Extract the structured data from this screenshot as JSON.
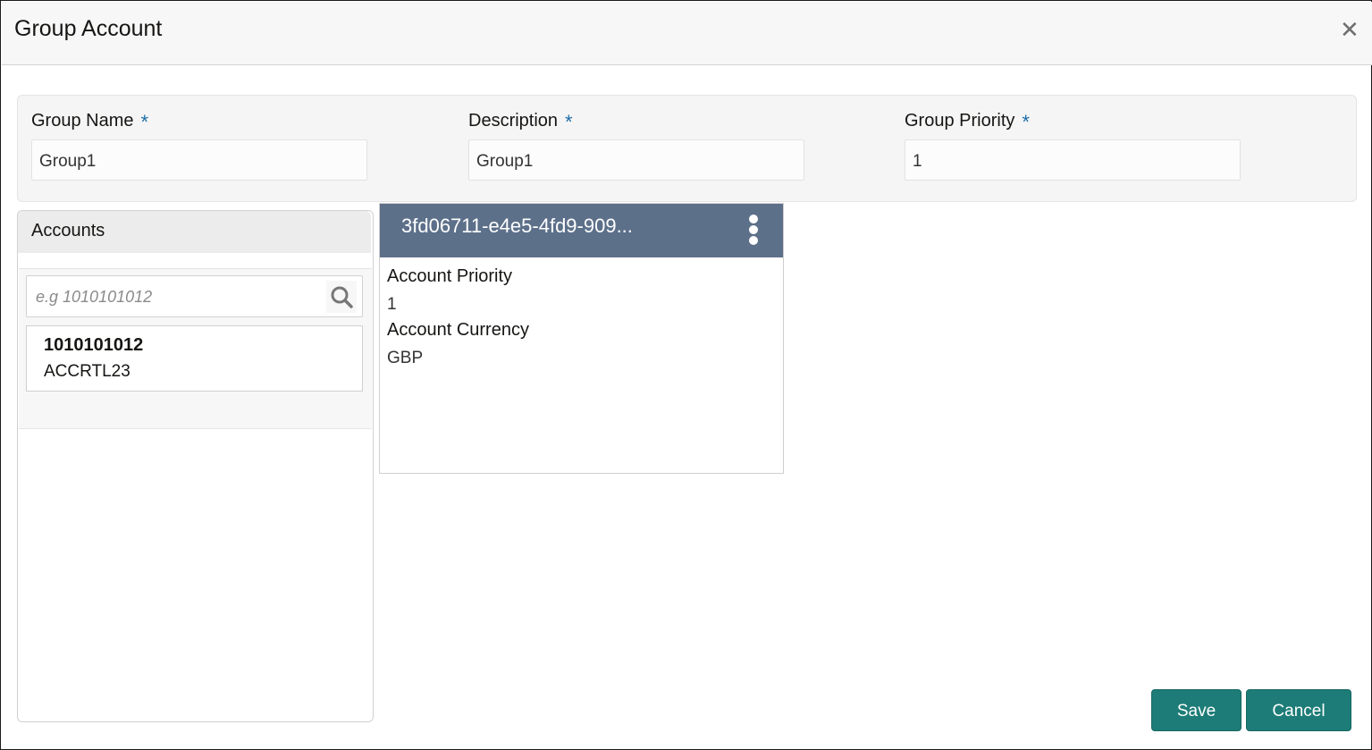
{
  "dialog": {
    "title": "Group Account",
    "close_icon": "close-icon"
  },
  "form": {
    "required_marker": "*",
    "fields": [
      {
        "label": "Group Name",
        "value": "Group1"
      },
      {
        "label": "Description",
        "value": "Group1"
      },
      {
        "label": "Group Priority",
        "value": "1"
      }
    ]
  },
  "accounts": {
    "header": "Accounts",
    "search_placeholder": "e.g 1010101012",
    "search_icon": "search-icon",
    "items": [
      {
        "number": "1010101012",
        "name": "ACCRTL23"
      }
    ]
  },
  "card": {
    "title": "3fd06711-e4e5-4fd9-909...",
    "menu_icon": "kebab-menu-icon",
    "fields": [
      {
        "label": "Account Priority",
        "value": "1"
      },
      {
        "label": "Account Currency",
        "value": "GBP"
      }
    ]
  },
  "footer": {
    "save_label": "Save",
    "cancel_label": "Cancel"
  },
  "colors": {
    "header_bg": "#f7f7f7",
    "card_header_bg": "#5d708a",
    "button_bg": "#1d7c77",
    "required": "#1f6fa8"
  }
}
